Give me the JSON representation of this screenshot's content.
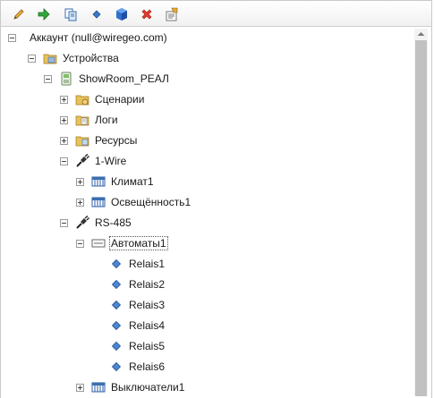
{
  "toolbar": {
    "items": [
      {
        "icon": "pencil-icon"
      },
      {
        "icon": "green-arrow-icon"
      },
      {
        "icon": "copy-icon"
      },
      {
        "icon": "blue-diamond-icon"
      },
      {
        "icon": "blue-cube-icon"
      },
      {
        "icon": "red-x-icon"
      },
      {
        "icon": "properties-icon"
      }
    ]
  },
  "tree": {
    "account": "Аккаунт (null@wiregeo.com)",
    "devices": "Устройства",
    "showroom": "ShowRoom_РЕАЛ",
    "scenarios": "Сценарии",
    "logs": "Логи",
    "resources": "Ресурсы",
    "onewire": "1-Wire",
    "climate": "Климат1",
    "lighting": "Освещённость1",
    "rs485": "RS-485",
    "automats": "Автоматы1",
    "relais": [
      "Relais1",
      "Relais2",
      "Relais3",
      "Relais4",
      "Relais5",
      "Relais6"
    ],
    "switches": "Выключатели1"
  },
  "colors": {
    "accent_blue": "#3a6fb0",
    "folder_yellow": "#e8c25a",
    "scrollbar": "#c1c1c1"
  }
}
